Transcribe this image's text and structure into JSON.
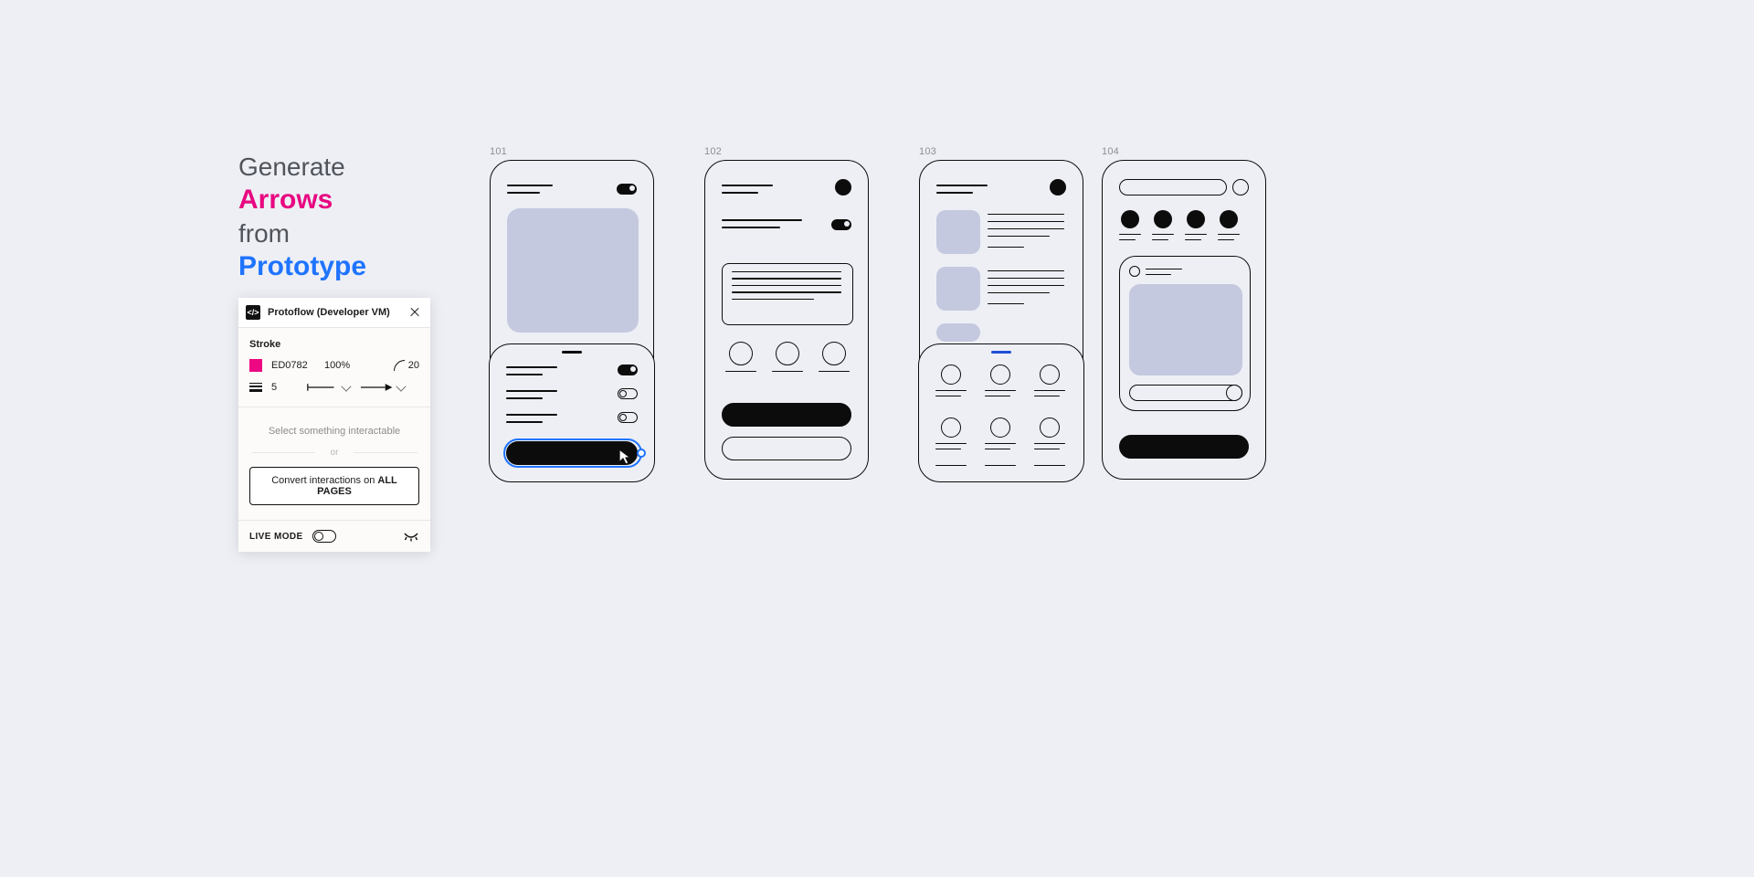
{
  "headline": {
    "line1": "Generate",
    "line2": "Arrows",
    "line3": "from",
    "line4": "Prototype"
  },
  "panel": {
    "title": "Protoflow (Developer VM)",
    "stroke_section_label": "Stroke",
    "color_hex": "ED0782",
    "color_opacity": "100%",
    "corner_radius": "20",
    "stroke_weight": "5",
    "prompt_text": "Select something interactable",
    "or_label": "or",
    "convert_prefix": "Convert interactions on ",
    "convert_bold": "ALL PAGES",
    "live_mode_label": "LIVE MODE",
    "live_mode_on": false
  },
  "frames": {
    "f101": "101",
    "f102": "102",
    "f103": "103",
    "f104": "104"
  }
}
